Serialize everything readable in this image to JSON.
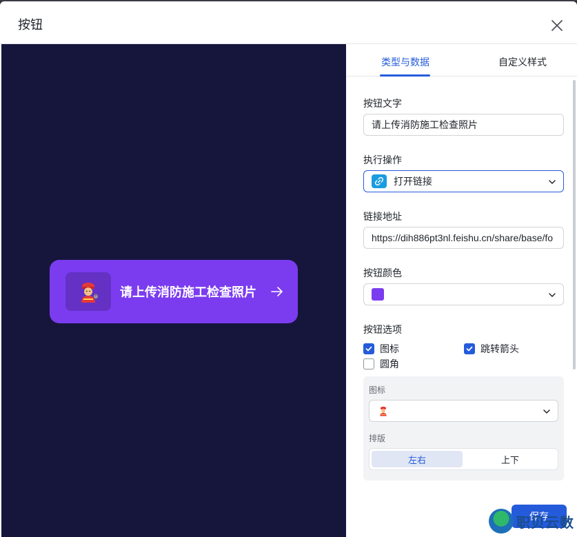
{
  "dialog": {
    "title": "按钮"
  },
  "preview": {
    "button_text": "请上传消防施工检查照片",
    "icon": "firefighter-emoji",
    "icon_glyph": "🧑‍🚒",
    "button_color": "#7b3cf0",
    "background_color": "#16163d"
  },
  "tabs": [
    {
      "label": "类型与数据",
      "active": true
    },
    {
      "label": "自定义样式",
      "active": false
    }
  ],
  "form": {
    "button_text_label": "按钮文字",
    "button_text_value": "请上传消防施工检查照片",
    "action_label": "执行操作",
    "action_value": "打开链接",
    "link_label": "链接地址",
    "link_value": "https://dih886pt3nl.feishu.cn/share/base/fo",
    "color_label": "按钮颜色",
    "color_value": "#7b3cf0",
    "options_label": "按钮选项",
    "options": [
      {
        "label": "图标",
        "checked": true
      },
      {
        "label": "跳转箭头",
        "checked": true
      },
      {
        "label": "圆角",
        "checked": false
      }
    ],
    "icon_section": {
      "icon_label": "图标",
      "icon_glyph": "🧑‍🚒",
      "layout_label": "排版",
      "layout_options": [
        {
          "label": "左右",
          "active": true
        },
        {
          "label": "上下",
          "active": false
        }
      ]
    }
  },
  "footer": {
    "save_label": "保存",
    "watermark_text": "职贝云数"
  }
}
